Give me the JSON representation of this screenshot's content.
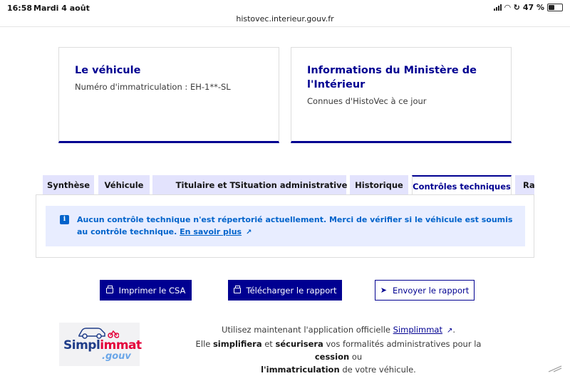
{
  "status_bar": {
    "time": "16:58",
    "date": "Mardi 4 août",
    "url": "histovec.interieur.gouv.fr",
    "battery": "47 %",
    "battery_level": 0.47
  },
  "cards": [
    {
      "title": "Le véhicule",
      "description": "Numéro d'immatriculation : EH-1**-SL"
    },
    {
      "title": "Informations du Ministère de l'Intérieur",
      "description": "Connues d'HistoVec à ce jour"
    }
  ],
  "tabs": [
    {
      "label": "Synthèse"
    },
    {
      "label": "Véhicule"
    },
    {
      "label": "Titulaire et Titre"
    },
    {
      "label": "Situation administrative"
    },
    {
      "label": "Historique"
    },
    {
      "label": "Contrôles techniques"
    },
    {
      "label": "Rap"
    }
  ],
  "active_tab": "Contrôles techniques",
  "notice": {
    "text": "Aucun contrôle technique n'est répertorié actuellement. Merci de vérifier si le véhicule est soumis au contrôle technique.",
    "link": "En savoir plus"
  },
  "buttons": {
    "print": "Imprimer le CSA",
    "download": "Télécharger le rapport",
    "send": "Envoyer le rapport"
  },
  "footer": {
    "logo_main_a": "Simpl",
    "logo_main_b": "immat",
    "logo_sub": ".gouv",
    "line1_prefix": "Utilisez maintenant l'application officielle",
    "line1_link": "Simplimmat",
    "line1_suffix": ".",
    "line2_a": "Elle",
    "line2_b": "simplifiera",
    "line2_c": "et",
    "line2_d": "sécurisera",
    "line2_e": "vos formalités administratives pour la",
    "line2_f": "cession",
    "line2_g": "ou",
    "line3_a": "l'immatriculation",
    "line3_b": "de votre véhicule."
  },
  "colors": {
    "primary": "#000091",
    "tab_bg": "#e3e3fd",
    "notice_bg": "#e8edff",
    "notice_text": "#0063cb"
  }
}
